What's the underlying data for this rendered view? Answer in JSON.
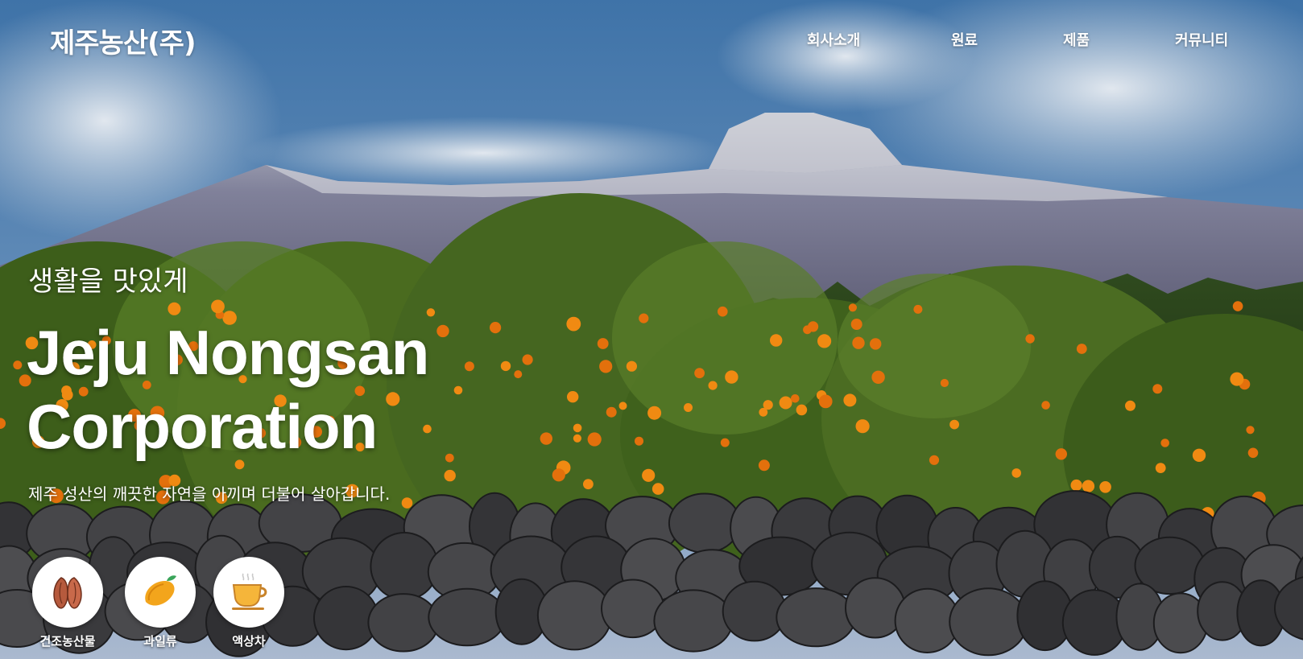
{
  "header": {
    "brand": "제주농산(주)",
    "nav": [
      {
        "label": "회사소개"
      },
      {
        "label": "원료"
      },
      {
        "label": "제품"
      },
      {
        "label": "커뮤니티"
      }
    ]
  },
  "hero": {
    "tagline": "생활을 맛있게",
    "headline_line1": "Jeju Nongsan",
    "headline_line2": "Corporation",
    "subtitle": "제주 성산의 깨끗한 자연을 아끼며 더불어 살아갑니다."
  },
  "categories": [
    {
      "label": "건조농산물",
      "icon": "almond-icon"
    },
    {
      "label": "과일류",
      "icon": "mango-icon"
    },
    {
      "label": "액상차",
      "icon": "tea-cup-icon"
    }
  ],
  "colors": {
    "sky": "#4f7fb0",
    "foliage": "#4a6a1e",
    "tangerine": "#f08a12",
    "stone": "#3a3a3c"
  }
}
